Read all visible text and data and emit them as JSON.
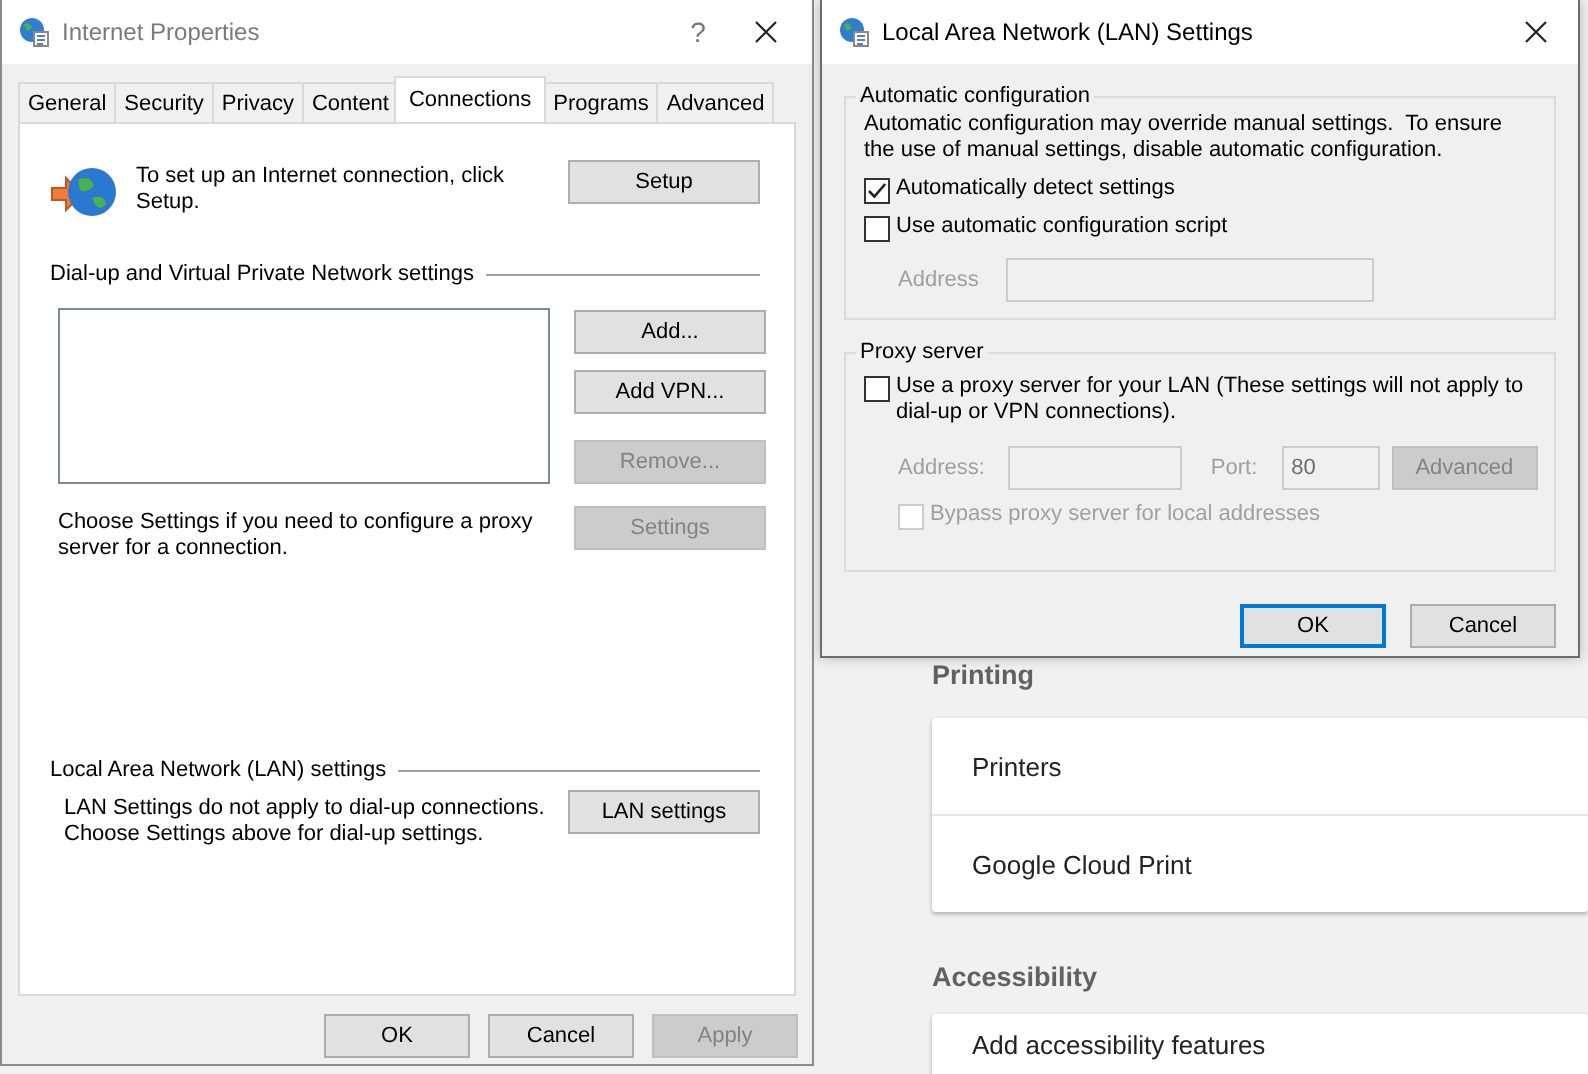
{
  "settings_page": {
    "sections": [
      {
        "heading": "Printing",
        "items": [
          "Printers",
          "Google Cloud Print"
        ]
      },
      {
        "heading": "Accessibility",
        "items": [
          "Add accessibility features"
        ]
      }
    ]
  },
  "internet_properties": {
    "title": "Internet Properties",
    "help": "?",
    "tabs": [
      {
        "label": "General",
        "selected": false
      },
      {
        "label": "Security",
        "selected": false
      },
      {
        "label": "Privacy",
        "selected": false
      },
      {
        "label": "Content",
        "selected": false
      },
      {
        "label": "Connections",
        "selected": true
      },
      {
        "label": "Programs",
        "selected": false
      },
      {
        "label": "Advanced",
        "selected": false
      }
    ],
    "setup_text": "To set up an Internet connection, click Setup.",
    "setup_button": {
      "label": "Setup",
      "disabled": false
    },
    "vpn_section": {
      "heading": "Dial-up and Virtual Private Network settings",
      "buttons": [
        {
          "label": "Add...",
          "disabled": false
        },
        {
          "label": "Add VPN...",
          "disabled": false
        },
        {
          "label": "Remove...",
          "disabled": true
        },
        {
          "label": "Settings",
          "disabled": true
        }
      ],
      "note": "Choose Settings if you need to configure a proxy server for a connection."
    },
    "lan_section": {
      "heading": "Local Area Network (LAN) settings",
      "note": "LAN Settings do not apply to dial-up connections. Choose Settings above for dial-up settings.",
      "button": {
        "label": "LAN settings",
        "disabled": false
      }
    },
    "footer_buttons": [
      {
        "label": "OK",
        "disabled": false
      },
      {
        "label": "Cancel",
        "disabled": false
      },
      {
        "label": "Apply",
        "disabled": true
      }
    ]
  },
  "lan_dialog": {
    "title": "Local Area Network (LAN) Settings",
    "auto_config": {
      "heading": "Automatic configuration",
      "description": "Automatic configuration may override manual settings.  To ensure the use of manual settings, disable automatic configuration.",
      "options": [
        {
          "label": "Automatically detect settings",
          "checked": true,
          "disabled": false
        },
        {
          "label": "Use automatic configuration script",
          "checked": false,
          "disabled": false
        }
      ],
      "address": {
        "label": "Address",
        "disabled": true
      }
    },
    "proxy": {
      "heading": "Proxy server",
      "use_proxy": {
        "label": "Use a proxy server for your LAN (These settings will not apply to dial-up or VPN connections).",
        "checked": false,
        "disabled": false
      },
      "address": {
        "label": "Address:",
        "disabled": true
      },
      "port": {
        "label": "Port:",
        "value": "80",
        "disabled": true
      },
      "advanced_button": {
        "label": "Advanced",
        "disabled": true
      },
      "bypass": {
        "label": "Bypass proxy server for local addresses",
        "checked": false,
        "disabled": true
      }
    },
    "buttons": [
      {
        "label": "OK",
        "default": true
      },
      {
        "label": "Cancel",
        "default": false
      }
    ]
  }
}
